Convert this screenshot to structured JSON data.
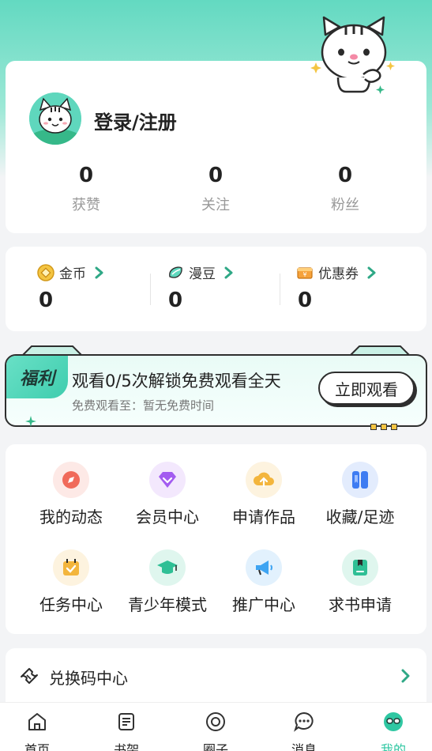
{
  "profile": {
    "login_label": "登录/注册",
    "stats": [
      {
        "value": "0",
        "label": "获赞"
      },
      {
        "value": "0",
        "label": "关注"
      },
      {
        "value": "0",
        "label": "粉丝"
      }
    ]
  },
  "wallet": [
    {
      "label": "金币",
      "value": "0"
    },
    {
      "label": "漫豆",
      "value": "0"
    },
    {
      "label": "优惠券",
      "value": "0"
    }
  ],
  "welfare": {
    "tag": "福利",
    "title": "观看0/5次解锁免费观看全天",
    "subtitle": "免费观看至：暂无免费时间",
    "button": "立即观看"
  },
  "menu": [
    {
      "label": "我的动态",
      "icon": "compass-icon",
      "color": "#f06a5a"
    },
    {
      "label": "会员中心",
      "icon": "diamond-icon",
      "color": "#a35cf0"
    },
    {
      "label": "申请作品",
      "icon": "upload-cloud-icon",
      "color": "#f3b53c"
    },
    {
      "label": "收藏/足迹",
      "icon": "bookmark-icon",
      "color": "#3e7cf2"
    },
    {
      "label": "任务中心",
      "icon": "calendar-check-icon",
      "color": "#f3b53c"
    },
    {
      "label": "青少年模式",
      "icon": "graduation-cap-icon",
      "color": "#2fbf95"
    },
    {
      "label": "推广中心",
      "icon": "megaphone-icon",
      "color": "#3ea4f2"
    },
    {
      "label": "求书申请",
      "icon": "book-icon",
      "color": "#2fbf95"
    }
  ],
  "redeem": {
    "label": "兑换码中心"
  },
  "tabs": [
    {
      "label": "首页"
    },
    {
      "label": "书架"
    },
    {
      "label": "圈子"
    },
    {
      "label": "消息"
    },
    {
      "label": "我的"
    }
  ],
  "colors": {
    "accent": "#2fc7a2",
    "header_bg": "#63d9c1"
  }
}
